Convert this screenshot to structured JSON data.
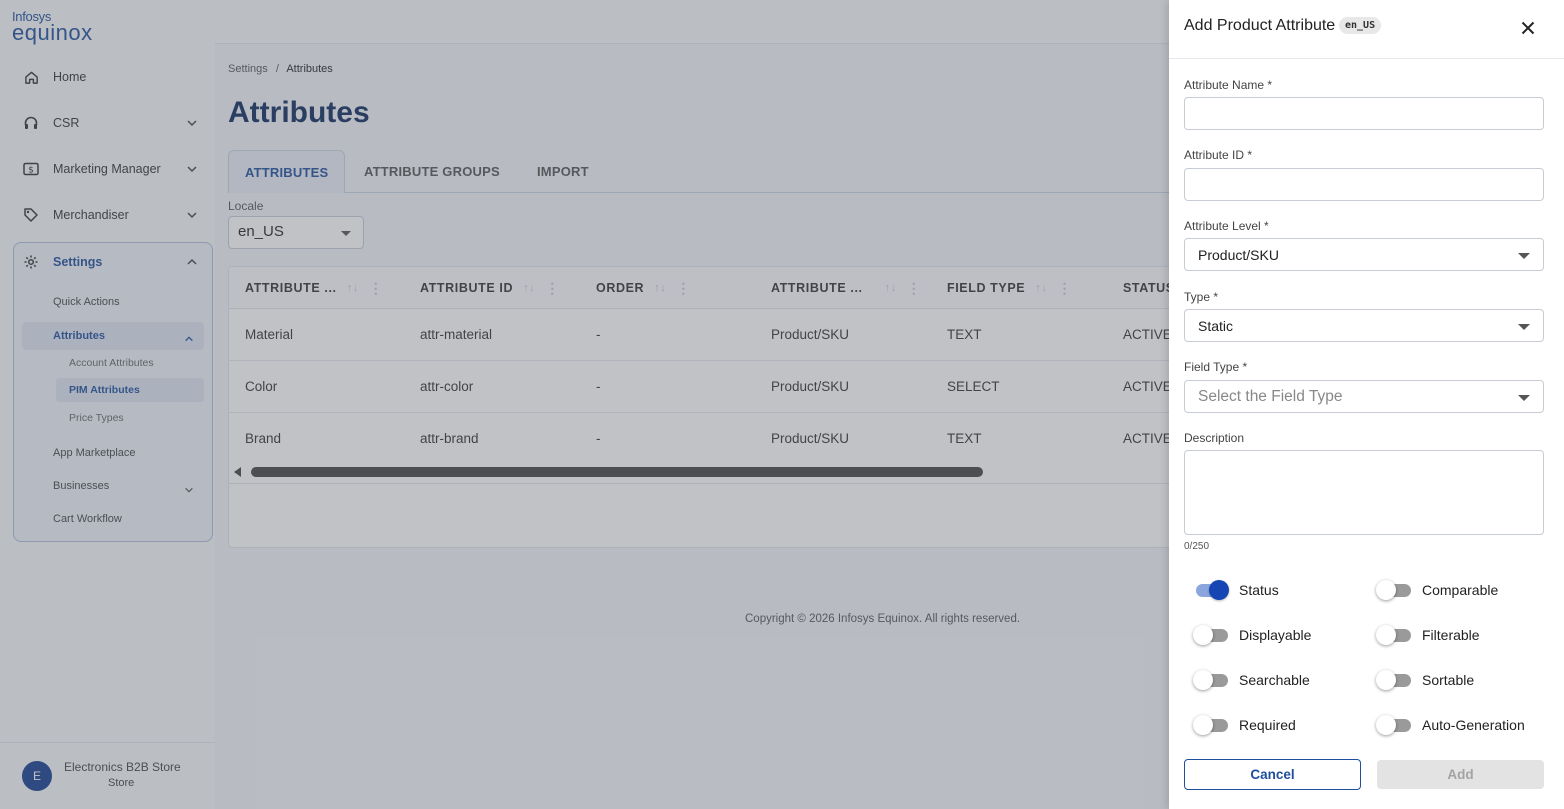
{
  "brand": {
    "line1": "Infosys",
    "line2": "equinox"
  },
  "sidebar": {
    "items": [
      {
        "label": "Home",
        "icon": "home-icon"
      },
      {
        "label": "CSR",
        "icon": "headset-icon"
      },
      {
        "label": "Marketing Manager",
        "icon": "dollar-icon"
      },
      {
        "label": "Merchandiser",
        "icon": "tag-icon"
      },
      {
        "label": "Settings",
        "icon": "gear-icon"
      }
    ],
    "settings_children": [
      "Quick Actions",
      "Attributes",
      "App Marketplace",
      "Businesses",
      "Cart Workflow"
    ],
    "attributes_children": [
      "Account Attributes",
      "PIM Attributes",
      "Price Types"
    ],
    "store": {
      "initial": "E",
      "name": "Electronics B2B Store",
      "type": "Store"
    }
  },
  "breadcrumb": {
    "parent": "Settings",
    "separator": "/",
    "current": "Attributes"
  },
  "page": {
    "title": "Attributes",
    "tabs": [
      "ATTRIBUTES",
      "ATTRIBUTE GROUPS",
      "IMPORT"
    ],
    "locale_label": "Locale",
    "locale_value": "en_US"
  },
  "table": {
    "columns": [
      "ATTRIBUTE ...",
      "ATTRIBUTE ID",
      "ORDER",
      "ATTRIBUTE ...",
      "FIELD TYPE",
      "STATUS"
    ],
    "rows": [
      [
        "Material",
        "attr-material",
        "-",
        "Product/SKU",
        "TEXT",
        "ACTIVE"
      ],
      [
        "Color",
        "attr-color",
        "-",
        "Product/SKU",
        "SELECT",
        "ACTIVE"
      ],
      [
        "Brand",
        "attr-brand",
        "-",
        "Product/SKU",
        "TEXT",
        "ACTIVE"
      ]
    ]
  },
  "footer": {
    "copyright": "Copyright © 2026 Infosys Equinox. All rights reserved."
  },
  "drawer": {
    "title": "Add Product Attribute",
    "locale_badge": "en_US",
    "fields": {
      "name_label": "Attribute Name *",
      "id_label": "Attribute ID *",
      "level_label": "Attribute Level *",
      "level_value": "Product/SKU",
      "type_label": "Type *",
      "type_value": "Static",
      "field_type_label": "Field Type *",
      "field_type_placeholder": "Select the Field Type",
      "description_label": "Description",
      "description_counter": "0/250"
    },
    "toggles": [
      {
        "label": "Status",
        "on": true
      },
      {
        "label": "Comparable",
        "on": false
      },
      {
        "label": "Displayable",
        "on": false
      },
      {
        "label": "Filterable",
        "on": false
      },
      {
        "label": "Searchable",
        "on": false
      },
      {
        "label": "Sortable",
        "on": false
      },
      {
        "label": "Required",
        "on": false
      },
      {
        "label": "Auto-Generation",
        "on": false
      }
    ],
    "cancel_label": "Cancel",
    "add_label": "Add"
  },
  "colors": {
    "accent": "#1f4e9c",
    "title": "#0e2a5e",
    "toggle_on": "#1646b3"
  }
}
